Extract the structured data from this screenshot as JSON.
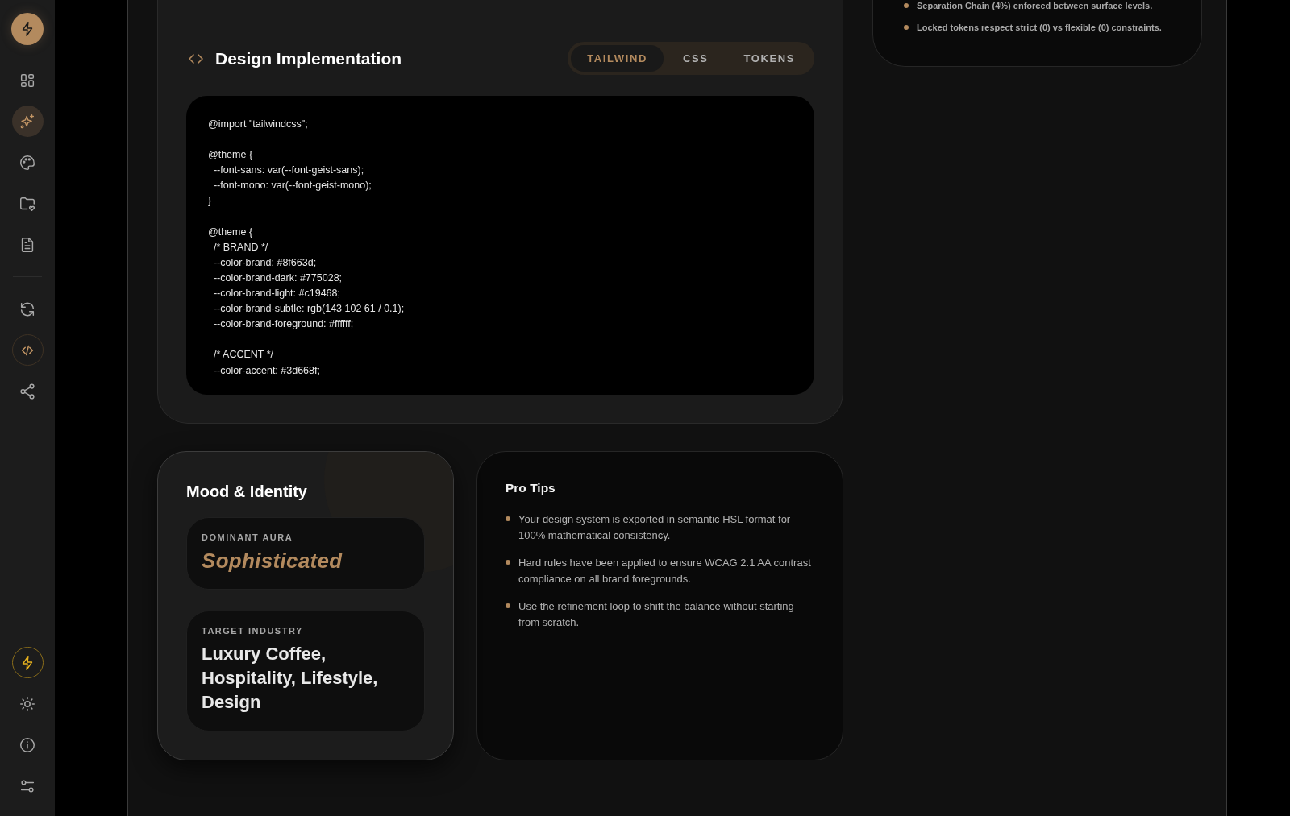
{
  "sidebar": {
    "nav_items": [
      {
        "selected": false,
        "outlined": false
      },
      {
        "selected": true,
        "outlined": false
      },
      {
        "selected": false,
        "outlined": false
      },
      {
        "selected": false,
        "outlined": false
      },
      {
        "selected": false,
        "outlined": false
      },
      {
        "selected": false,
        "outlined": false
      },
      {
        "selected": false,
        "outlined": true
      },
      {
        "selected": false,
        "outlined": false
      }
    ],
    "footer_items": [
      {
        "selected": false,
        "outlined": true
      },
      {
        "selected": false,
        "outlined": false
      },
      {
        "selected": false,
        "outlined": false
      },
      {
        "selected": false,
        "outlined": false
      }
    ]
  },
  "implementation": {
    "title": "Design Implementation",
    "tabs": [
      {
        "label": "TAILWIND",
        "selected": true
      },
      {
        "label": "CSS",
        "selected": false
      },
      {
        "label": "TOKENS",
        "selected": false
      }
    ],
    "code": "@import \"tailwindcss\";\n\n@theme {\n  --font-sans: var(--font-geist-sans);\n  --font-mono: var(--font-geist-mono);\n}\n\n@theme {\n  /* BRAND */\n  --color-brand: #8f663d;\n  --color-brand-dark: #775028;\n  --color-brand-light: #c19468;\n  --color-brand-subtle: rgb(143 102 61 / 0.1);\n  --color-brand-foreground: #ffffff;\n\n  /* ACCENT */\n  --color-accent: #3d668f;"
  },
  "mood": {
    "title": "Mood & Identity",
    "cards": [
      {
        "label": "DOMINANT AURA",
        "value": "Sophisticated",
        "kind": "accent"
      },
      {
        "label": "TARGET INDUSTRY",
        "value": "Luxury Coffee, Hospitality, Lifestyle, Design",
        "kind": "plain"
      }
    ]
  },
  "pro_tips": {
    "title": "Pro Tips",
    "items": [
      "Your design system is exported in semantic HSL format for 100% mathematical consistency.",
      "Hard rules have been applied to ensure WCAG 2.1 AA contrast compliance on all brand foregrounds.",
      "Use the refinement loop to shift the balance without starting from scratch."
    ]
  },
  "notes": {
    "items": [
      "Separation Chain (4%) enforced between surface levels.",
      "Locked tokens respect strict (0) vs flexible (0) constraints."
    ]
  }
}
